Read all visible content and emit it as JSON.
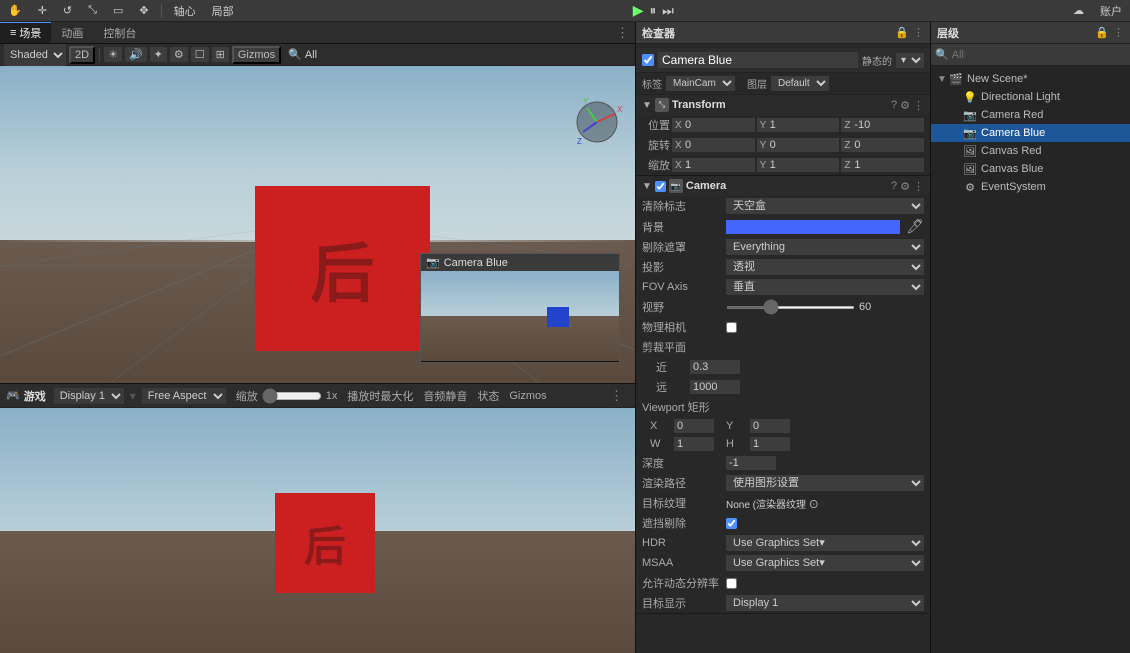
{
  "topToolbar": {
    "buttons": [
      "手形工具",
      "移动",
      "旋转",
      "缩放",
      "矩形",
      "变换"
    ],
    "pivotLabel": "轴心",
    "globalLabel": "局部",
    "playIcon": "▶",
    "pauseIcon": "⏸",
    "stepIcon": "⏭",
    "cloudIcon": "☁",
    "accountIcon": "账户"
  },
  "sceneTabs": {
    "sceneLabel": "场景",
    "animLabel": "动画",
    "controlLabel": "控制台"
  },
  "sceneToolbar": {
    "shadedLabel": "Shaded",
    "twodLabel": "2D",
    "gizmosLabel": "Gizmos",
    "allLabel": "All"
  },
  "sceneView": {
    "title": "场景",
    "cameraPreview": {
      "title": "Camera Blue"
    }
  },
  "gameView": {
    "title": "游戏",
    "displayLabel": "Display 1",
    "aspectLabel": "Free Aspect",
    "scaleLabel": "缩放",
    "scaleValue": "1x",
    "maxLabel": "播放时最大化",
    "muteLabel": "音频静音",
    "statusLabel": "状态",
    "gizmosLabel": "Gizmos",
    "charLabel": "后"
  },
  "inspector": {
    "title": "检查器",
    "objectName": "Camera Blue",
    "staticLabel": "静态的",
    "tagLabel": "标签",
    "tagValue": "MainCam",
    "layerLabel": "图层",
    "layerValue": "Default",
    "transform": {
      "title": "Transform",
      "posLabel": "位置",
      "rotLabel": "旋转",
      "scaleLabel": "缩放",
      "pos": {
        "x": "0",
        "y": "1",
        "z": "-10"
      },
      "rot": {
        "x": "0",
        "y": "0",
        "z": "0"
      },
      "scale": {
        "x": "1",
        "y": "1",
        "z": "1"
      }
    },
    "camera": {
      "title": "Camera",
      "clearFlagsLabel": "清除标志",
      "clearFlagsValue": "天空盒",
      "bgLabel": "背景",
      "bgColor": "#4466ff",
      "cullingLabel": "剔除遮罩",
      "cullingValue": "Everything",
      "projLabel": "投影",
      "projValue": "透视",
      "fovAxisLabel": "FOV Axis",
      "fovAxisValue": "垂直",
      "fovLabel": "视野",
      "fovValue": "60",
      "physicalLabel": "物理相机",
      "clipLabel": "剪裁平面",
      "nearLabel": "近",
      "nearValue": "0.3",
      "farLabel": "远",
      "farValue": "1000",
      "viewportLabel": "Viewport 矩形",
      "vpX": "0",
      "vpY": "0",
      "vpW": "1",
      "vpH": "1",
      "depthLabel": "深度",
      "depthValue": "-1",
      "renderPathLabel": "渲染路径",
      "renderPathValue": "使用图形设置",
      "targetTexLabel": "目标纹理",
      "targetTexValue": "None (渲染器纹理 ⊙",
      "occlusionLabel": "遮挡剔除",
      "hdrLabel": "HDR",
      "hdrValue": "Use Graphics Set▾",
      "msaaLabel": "MSAA",
      "msaaValue": "Use Graphics Set▾",
      "dynamicLabel": "允许动态分辨率",
      "displayLabel": "目标显示",
      "displayValue": "Display 1"
    }
  },
  "hierarchy": {
    "title": "层级",
    "searchPlaceholder": "All",
    "items": [
      {
        "label": "New Scene*",
        "level": 0,
        "hasArrow": true,
        "selected": false,
        "id": "new-scene"
      },
      {
        "label": "Directional Light",
        "level": 1,
        "hasArrow": false,
        "selected": false,
        "id": "dir-light"
      },
      {
        "label": "Camera Red",
        "level": 1,
        "hasArrow": false,
        "selected": false,
        "id": "cam-red"
      },
      {
        "label": "Camera Blue",
        "level": 1,
        "hasArrow": false,
        "selected": true,
        "id": "cam-blue"
      },
      {
        "label": "Canvas Red",
        "level": 1,
        "hasArrow": false,
        "selected": false,
        "id": "canvas-red"
      },
      {
        "label": "Canvas Blue",
        "level": 1,
        "hasArrow": false,
        "selected": false,
        "id": "canvas-blue"
      },
      {
        "label": "EventSystem",
        "level": 1,
        "hasArrow": false,
        "selected": false,
        "id": "event-sys"
      }
    ]
  }
}
